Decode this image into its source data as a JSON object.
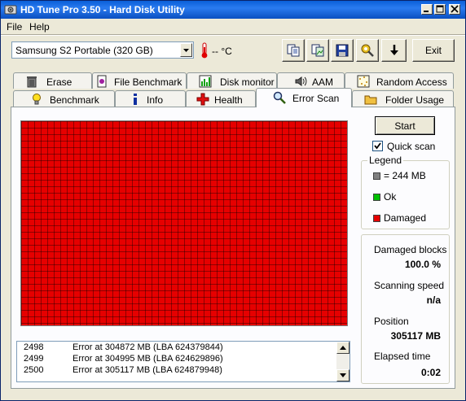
{
  "window": {
    "title": "HD Tune Pro 3.50 - Hard Disk Utility",
    "icon": "hdd-app-icon"
  },
  "menu": [
    {
      "label": "File",
      "accel": "F"
    },
    {
      "label": "Help",
      "accel": "H"
    }
  ],
  "toolbar": {
    "drive_selected": "Samsung S2 Portable (320 GB)",
    "temperature": "-- °C",
    "exit_label": "Exit",
    "icons": [
      "copy-text-icon",
      "copy-screenshot-icon",
      "save-icon",
      "options-icon",
      "download-icon"
    ]
  },
  "tabs_top": [
    "Erase",
    "File Benchmark",
    "Disk monitor",
    "AAM",
    "Random Access"
  ],
  "tabs_bottom": [
    "Benchmark",
    "Info",
    "Health",
    "Error Scan",
    "Folder Usage"
  ],
  "active_tab": "Error Scan",
  "scan": {
    "start_label": "Start",
    "quick_scan_label": "Quick scan",
    "quick_scan_checked": true
  },
  "legend": {
    "title": "Legend",
    "items": [
      {
        "label": "= 244 MB",
        "color": "#808080"
      },
      {
        "label": "Ok",
        "color": "#00c000"
      },
      {
        "label": "Damaged",
        "color": "#e60000"
      }
    ]
  },
  "stats": {
    "damaged_blocks_label": "Damaged blocks",
    "damaged_blocks_value": "100.0 %",
    "speed_label": "Scanning speed",
    "speed_value": "n/a",
    "position_label": "Position",
    "position_value": "305117 MB",
    "elapsed_label": "Elapsed time",
    "elapsed_value": "0:02"
  },
  "log": [
    {
      "num": "2498",
      "msg": "Error at 304872 MB (LBA 624379844)"
    },
    {
      "num": "2499",
      "msg": "Error at 304995 MB (LBA 624629896)"
    },
    {
      "num": "2500",
      "msg": "Error at 305117 MB (LBA 624879948)"
    }
  ],
  "colors": {
    "damaged": "#e60000",
    "titlebar": "#0a5fd8"
  }
}
